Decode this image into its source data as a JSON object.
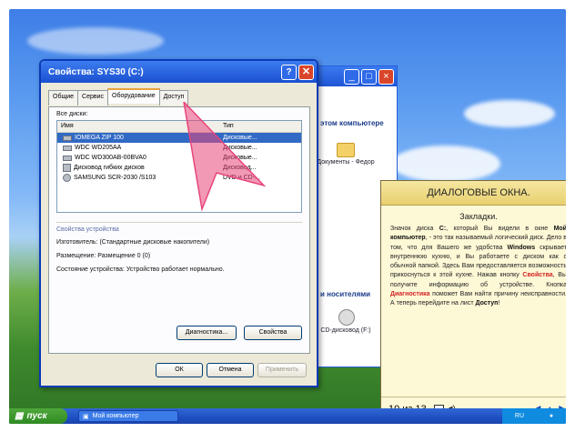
{
  "dialog": {
    "title": "Свойства: SYS30 (C:)",
    "help_glyph": "?",
    "close_glyph": "✕",
    "tabs": [
      "Общие",
      "Сервис",
      "Оборудование",
      "Доступ"
    ],
    "active_tab": "Оборудование",
    "all_disks_label": "Все диски:",
    "col_name": "Имя",
    "col_type": "Тип",
    "disks": [
      {
        "name": "IOMEGA ZIP 100",
        "type": "Дисковые...",
        "selected": true
      },
      {
        "name": "WDC WD205AA",
        "type": "Дисковые..."
      },
      {
        "name": "WDC WD300AB-00BVA0",
        "type": "Дисковые..."
      },
      {
        "name": "Дисковод гибких дисков",
        "type": "Дисковод..."
      },
      {
        "name": "SAMSUNG SCR-2030 /S103",
        "type": "DVD и CD-..."
      }
    ],
    "props_title": "Свойства устройства",
    "manufacturer": "Изготовитель: (Стандартные дисковые накопители)",
    "location": "Размещение: Размещение 0 (0)",
    "status": "Состояние устройства: Устройство работает нормально.",
    "btn_diagnostics": "Диагностика...",
    "btn_properties": "Свойства",
    "btn_ok": "ОК",
    "btn_cancel": "Отмена",
    "btn_apply": "Применить"
  },
  "explorer": {
    "section1": "этом компьютере",
    "folder_label": "Документы - Федор",
    "section2": "и носителями",
    "cd_label": "CD-дисковод (F:)"
  },
  "lesson": {
    "header": "ДИАЛОГОВЫЕ ОКНА.",
    "subheader": "Закладки.",
    "p1": "Значок диска ",
    "p1b": "С:",
    "p2": ", который Вы видели в окне ",
    "p2b": "Мой компьютер",
    "p3": ", - это так называемый логический диск. Дело в том, что для Вашего же удобства ",
    "p3b": "Windows",
    "p4": " скрывает внутреннюю кухню, и Вы работаете с диском как с обычной папкой. Здесь Вам предоставляется возможность прикоснуться к этой кухне. Нажав кнопку ",
    "p4r": "Свойства",
    "p5": ", Вы получите информацию об устройстве. Кнопка ",
    "p5r": "Диагностика",
    "p6": " поможет Вам найти причину неисправности. А теперь перейдите на лист ",
    "p6b": "Доступ",
    "p7": "!",
    "page": "10 из 13"
  },
  "taskbar": {
    "start": "пуск",
    "task": "Мой компьютер",
    "lang": "RU"
  },
  "colors": {
    "accent": "#e8457a",
    "red_text": "#d32323"
  }
}
